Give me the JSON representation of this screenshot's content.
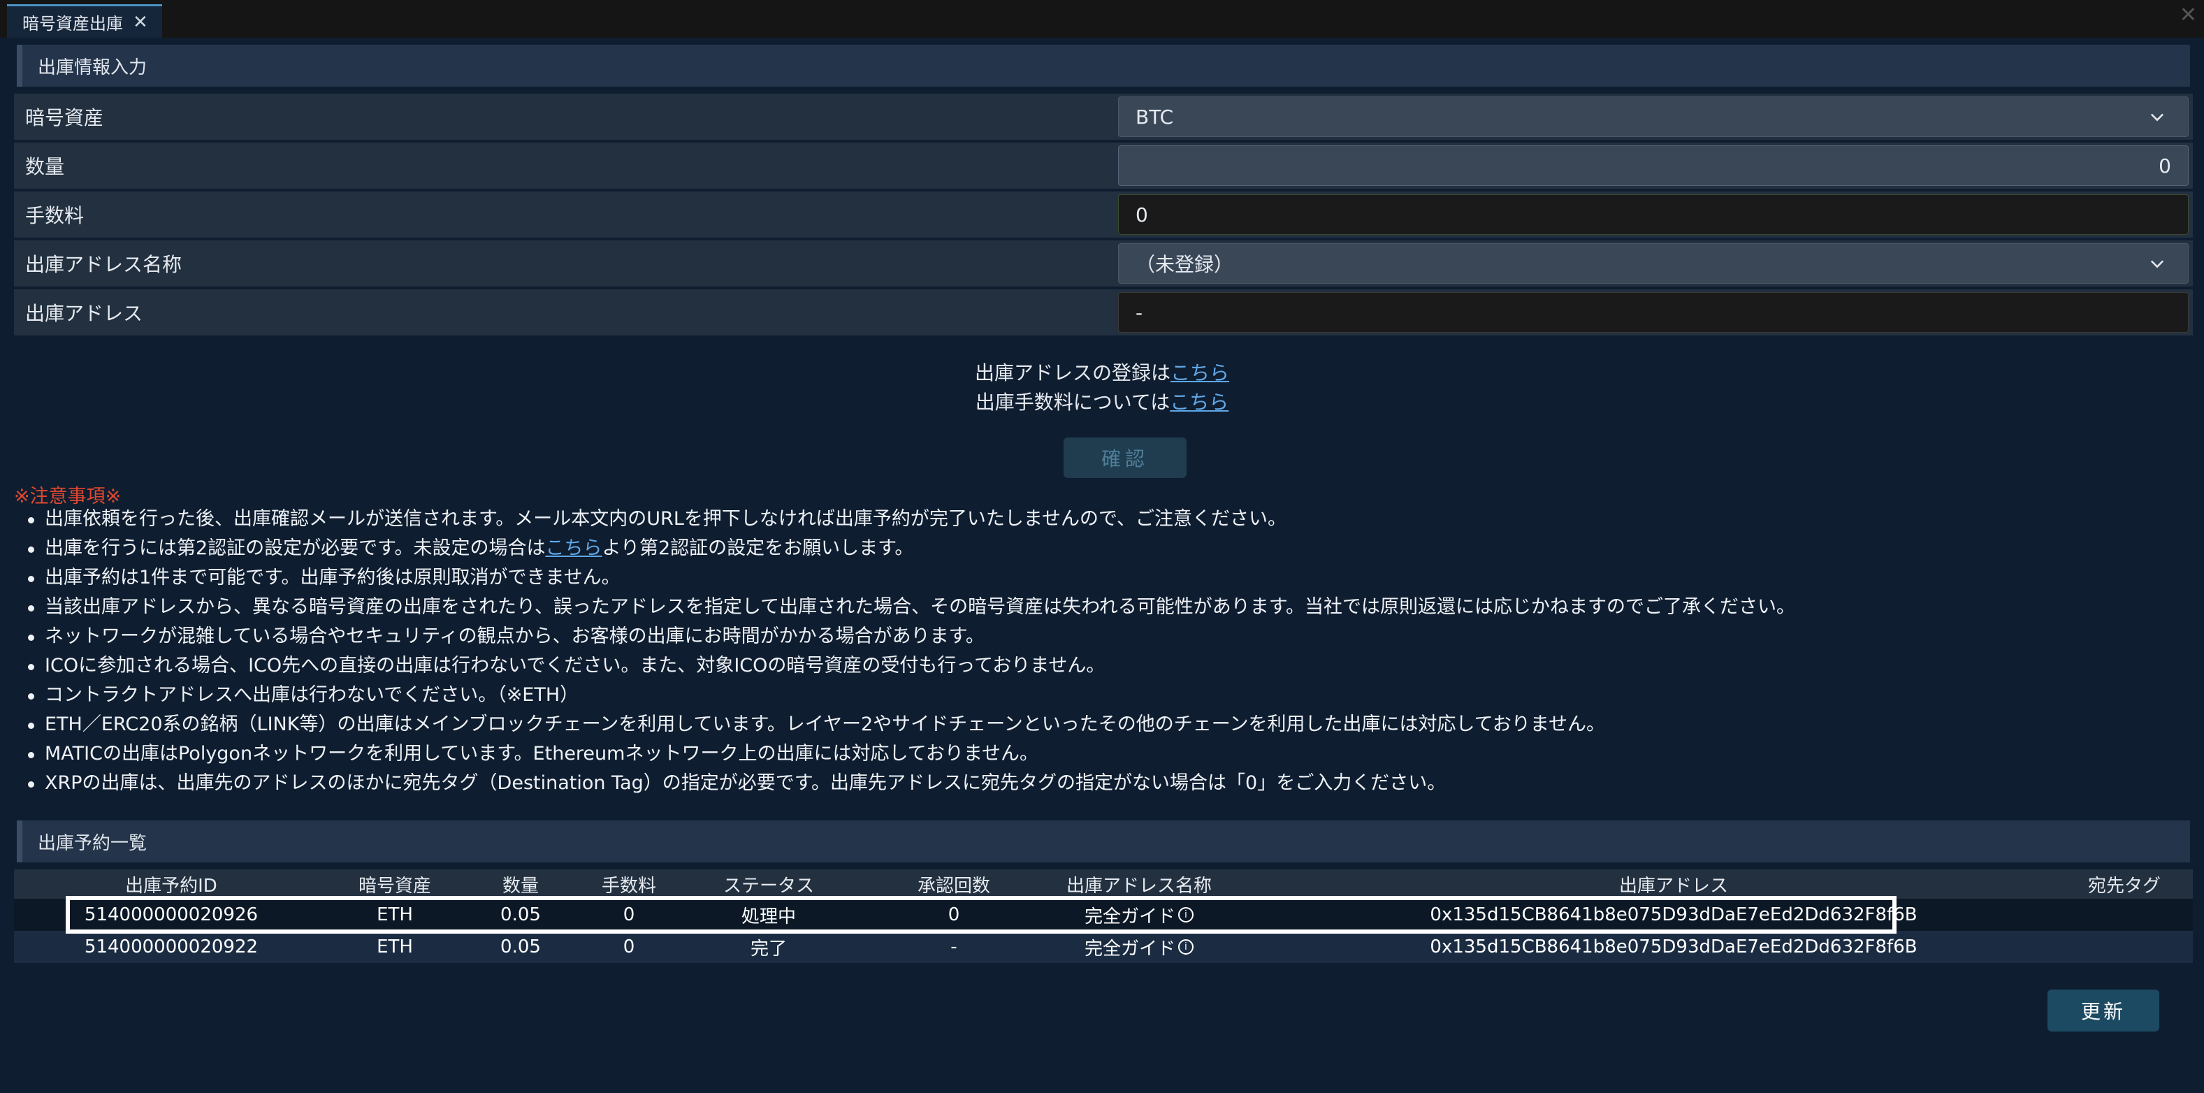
{
  "tab": {
    "title": "暗号資産出庫"
  },
  "form_section": {
    "header": "出庫情報入力",
    "rows": [
      {
        "label": "暗号資産",
        "value": "BTC"
      },
      {
        "label": "数量",
        "value": "0"
      },
      {
        "label": "手数料",
        "value": "0"
      },
      {
        "label": "出庫アドレス名称",
        "value": "（未登録）"
      },
      {
        "label": "出庫アドレス",
        "value": "-"
      }
    ]
  },
  "links": {
    "line1_prefix": "出庫アドレスの登録は",
    "line1_link": "こちら",
    "line2_prefix": "出庫手数料については",
    "line2_link": "こちら"
  },
  "confirm_button": "確認",
  "notice": {
    "title": "※注意事項※",
    "items": [
      "出庫依頼を行った後、出庫確認メールが送信されます。メール本文内のURLを押下しなければ出庫予約が完了いたしませんので、ご注意ください。",
      "出庫を行うには第2認証の設定が必要です。未設定の場合は",
      "出庫予約は1件まで可能です。出庫予約後は原則取消ができません。",
      "当該出庫アドレスから、異なる暗号資産の出庫をされたり、誤ったアドレスを指定して出庫された場合、その暗号資産は失われる可能性があります。当社では原則返還には応じかねますのでご了承ください。",
      "ネットワークが混雑している場合やセキュリティの観点から、お客様の出庫にお時間がかかる場合があります。",
      "ICOに参加される場合、ICO先への直接の出庫は行わないでください。また、対象ICOの暗号資産の受付も行っておりません。",
      "コントラクトアドレスへ出庫は行わないでください。（※ETH）",
      "ETH／ERC20系の銘柄（LINK等）の出庫はメインブロックチェーンを利用しています。レイヤー2やサイドチェーンといったその他のチェーンを利用した出庫には対応しておりません。",
      "MATICの出庫はPolygonネットワークを利用しています。Ethereumネットワーク上の出庫には対応しておりません。",
      "XRPの出庫は、出庫先のアドレスのほかに宛先タグ（Destination Tag）の指定が必要です。出庫先アドレスに宛先タグの指定がない場合は「0」をご入力ください。"
    ],
    "item2_link": "こちら",
    "item2_suffix": "より第2認証の設定をお願いします。"
  },
  "reservation_section": {
    "header": "出庫予約一覧",
    "columns": [
      "出庫予約ID",
      "暗号資産",
      "数量",
      "手数料",
      "ステータス",
      "承認回数",
      "出庫アドレス名称",
      "出庫アドレス",
      "宛先タグ"
    ],
    "rows": [
      [
        "514000000020926",
        "ETH",
        "0.05",
        "0",
        "処理中",
        "0",
        "完全ガイド",
        "0x135d15CB8641b8e075D93dDaE7eEd2Dd632F8f6B",
        ""
      ],
      [
        "514000000020922",
        "ETH",
        "0.05",
        "0",
        "完了",
        "-",
        "完全ガイド",
        "0x135d15CB8641b8e075D93dDaE7eEd2Dd632F8f6B",
        ""
      ]
    ]
  },
  "refresh_button": "更新",
  "colors": {
    "background": "#0f1d30",
    "link": "#5fa8e8",
    "notice_title": "#e0492f"
  },
  "icons": [
    "close-icon",
    "chevron-down-icon",
    "info-icon"
  ]
}
